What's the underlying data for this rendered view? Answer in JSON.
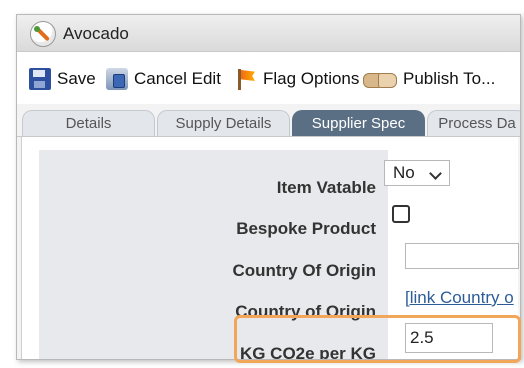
{
  "window": {
    "title": "Avocado",
    "app_icon": "avocado-icon"
  },
  "toolbar": {
    "save_label": "Save",
    "cancel_edit_label": "Cancel Edit",
    "flag_options_label": "Flag Options",
    "publish_label": "Publish To..."
  },
  "tabs": [
    {
      "label": "Details"
    },
    {
      "label": "Supply Details"
    },
    {
      "label": "Supplier Spec",
      "active": true
    },
    {
      "label": "Process Da"
    }
  ],
  "form": {
    "item_vatable": {
      "label": "Item Vatable",
      "value": "No"
    },
    "bespoke_product": {
      "label": "Bespoke Product",
      "checked": false
    },
    "country_of_origin": {
      "label": "Country Of Origin",
      "value": ""
    },
    "country_of_origin_link": {
      "label": "Country of Origin",
      "link_text": "[link Country o"
    },
    "kg_co2e": {
      "label": "KG CO2e per KG",
      "value": "2.5"
    }
  },
  "colors": {
    "active_tab": "#5b6f84",
    "highlight": "#f2a65a",
    "link": "#2c5d99"
  }
}
